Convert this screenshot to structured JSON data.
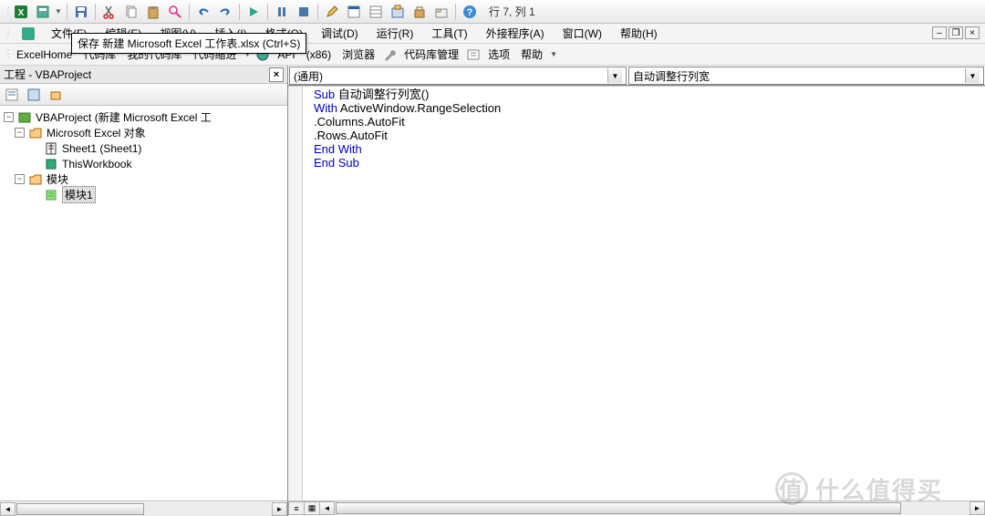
{
  "status": {
    "cursor_pos": "行 7, 列 1"
  },
  "tooltip": "保存 新建 Microsoft Excel 工作表.xlsx (Ctrl+S)",
  "menu": {
    "file": "文件(F)",
    "edit": "编辑(E)",
    "view": "视图(V)",
    "insert": "插入(I)",
    "format": "格式(O)",
    "debug": "调试(D)",
    "run": "运行(R)",
    "tools": "工具(T)",
    "addins": "外接程序(A)",
    "window": "窗口(W)",
    "help": "帮助(H)"
  },
  "toolbar2": {
    "excelhome": "ExcelHome",
    "codelib": "代码库",
    "mycodelib": "我的代码库",
    "codeindent": "代码缩进",
    "api": "API",
    "x86": "(x86)",
    "browser": "浏览器",
    "codemgr": "代码库管理",
    "options": "选项",
    "help": "帮助"
  },
  "project": {
    "title": "工程 - VBAProject",
    "root": "VBAProject (新建 Microsoft Excel 工",
    "excel_objects": "Microsoft Excel 对象",
    "sheet1": "Sheet1 (Sheet1)",
    "thiswb": "ThisWorkbook",
    "modules": "模块",
    "module1": "模块1"
  },
  "code_header": {
    "left": "(通用)",
    "right": "自动调整行列宽"
  },
  "code": {
    "l1a": "Sub",
    "l1b": " 自动调整行列宽()",
    "l2a": "With",
    "l2b": " ActiveWindow.RangeSelection",
    "l3": ".Columns.AutoFit",
    "l4": ".Rows.AutoFit",
    "l5": "End With",
    "l6": "End Sub"
  }
}
